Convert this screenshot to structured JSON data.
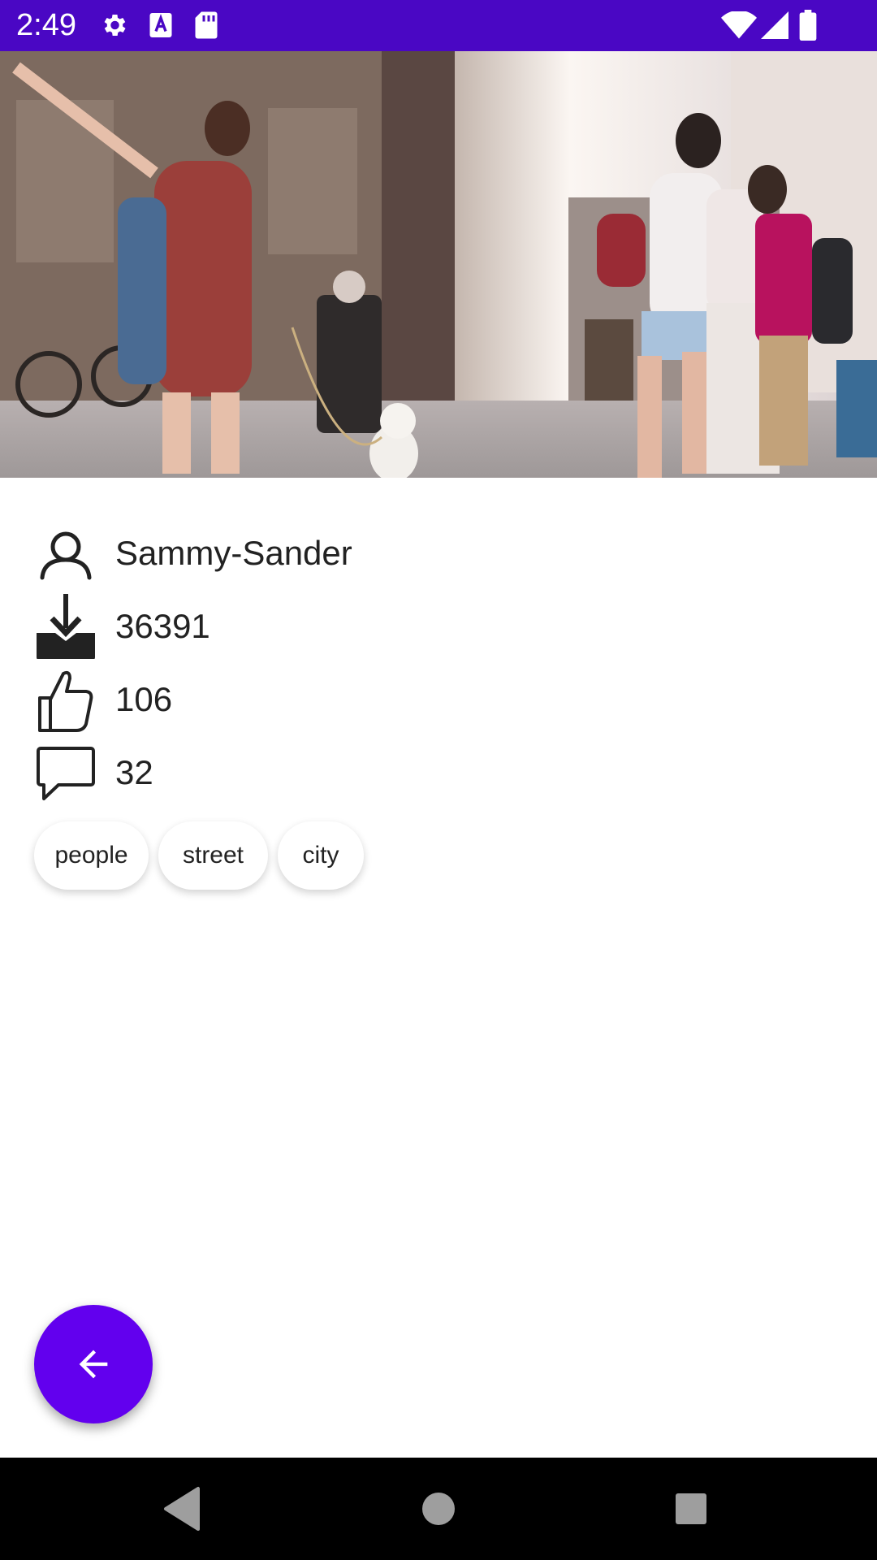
{
  "status_bar": {
    "time": "2:49",
    "background": "#4a07c4",
    "icons_left": [
      "gear-icon",
      "a-badge-icon",
      "sd-card-icon"
    ],
    "icons_right": [
      "wifi-icon",
      "signal-icon",
      "battery-icon"
    ]
  },
  "photo": {
    "subject": "people-walking-street-photo"
  },
  "details": {
    "user": {
      "icon": "user-icon",
      "value": "Sammy-Sander"
    },
    "downloads": {
      "icon": "download-icon",
      "value": "36391"
    },
    "likes": {
      "icon": "thumbs-up-icon",
      "value": "106"
    },
    "comments": {
      "icon": "comment-icon",
      "value": "32"
    }
  },
  "tags": [
    "people",
    "street",
    "city"
  ],
  "fab": {
    "icon": "arrow-back-icon",
    "color": "#6200ee"
  },
  "nav_bar": {
    "buttons": [
      "back-triangle-icon",
      "home-circle-icon",
      "recents-square-icon"
    ]
  }
}
